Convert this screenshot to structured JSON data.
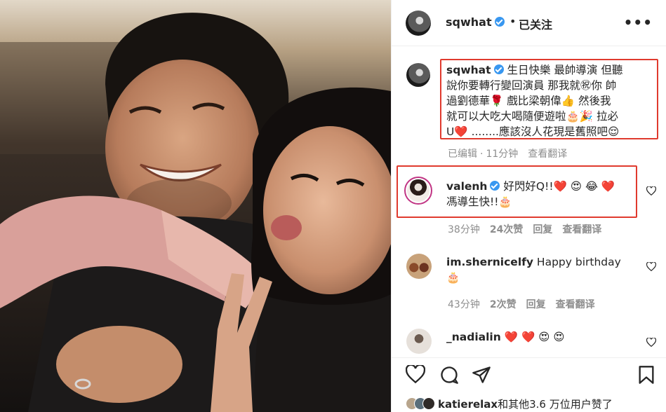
{
  "post": {
    "author": "sqwhat",
    "follow_sep": "•",
    "follow_status": "已关注",
    "more_label": "•••"
  },
  "caption": {
    "username": "sqwhat",
    "text_lines": [
      "生日快樂 最帥導演 但聽",
      "說你要轉行變回演員 那我就㊗你 帥",
      "過劉德華🌹 戲比梁朝偉👍 然後我",
      "就可以大吃大喝隨便遊啦🎂🎉 拉必",
      "U❤️  ........應該沒人花現是舊照吧😌"
    ],
    "meta": {
      "edited": "已编辑",
      "sep": "·",
      "time": "11分钟",
      "translate": "查看翻译"
    }
  },
  "comments": [
    {
      "username": "valenh",
      "verified": true,
      "text_lines": [
        "好閃好Q!!❤️ 😍 😂 ❤️",
        "馮導生快!!🎂"
      ],
      "meta": {
        "time": "38分钟",
        "likes": "24次赞",
        "reply": "回复",
        "translate": "查看翻译"
      }
    },
    {
      "username": "im.shernicelfy",
      "verified": false,
      "text_lines": [
        "Happy birthday",
        "🎂"
      ],
      "meta": {
        "time": "43分钟",
        "likes": "2次赞",
        "reply": "回复",
        "translate": "查看翻译"
      }
    },
    {
      "username": "_nadialin",
      "verified": false,
      "text_lines": [
        "❤️ ❤️ 😍 😍"
      ]
    }
  ],
  "likes_summary": {
    "prefix": "katierelax",
    "suffix": "和其他3.6 万位用户赞了"
  },
  "colors": {
    "highlight_box": "#e03a2e",
    "verified": "#3897f0",
    "meta_gray": "#8e8e8e",
    "text": "#262626"
  },
  "icons": [
    "heart-icon",
    "comment-icon",
    "share-icon",
    "bookmark-icon",
    "more-icon",
    "verified-icon"
  ]
}
